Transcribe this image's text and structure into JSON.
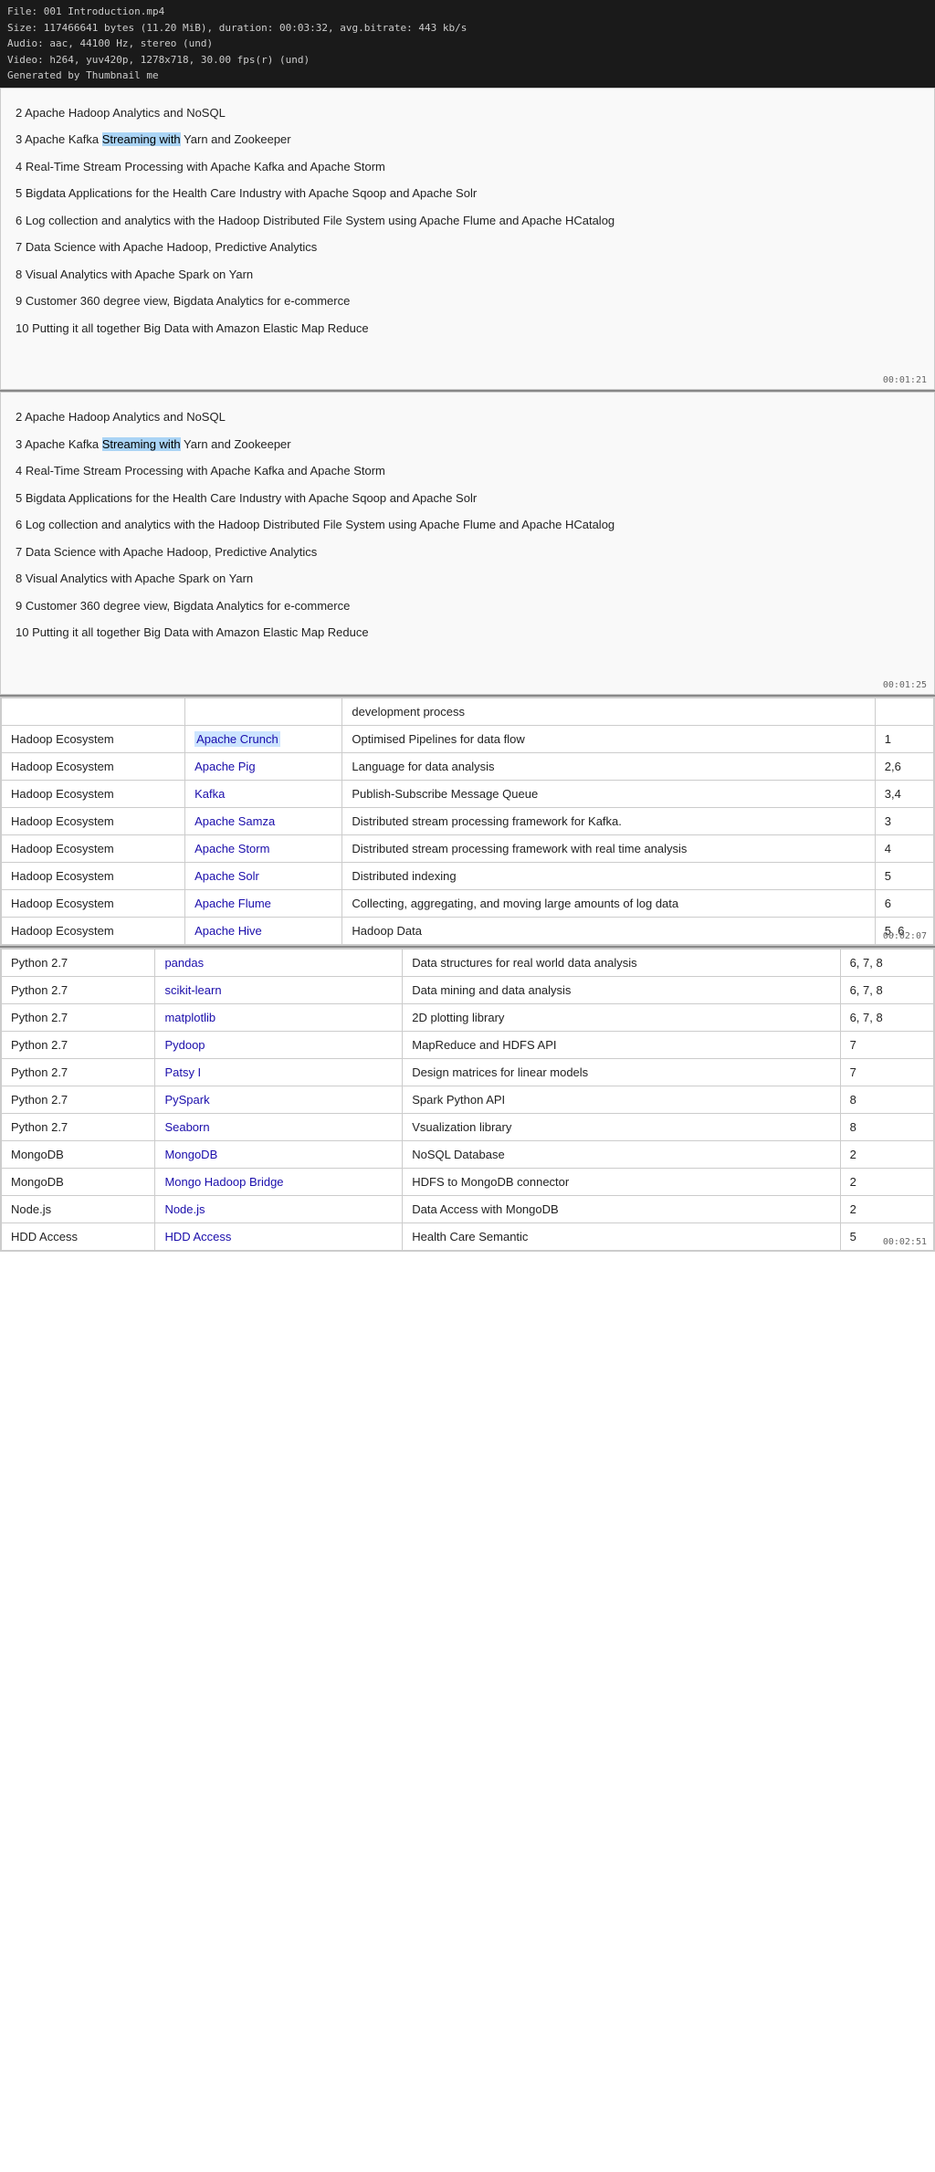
{
  "videoInfo": {
    "file": "File: 001 Introduction.mp4",
    "size": "Size: 117466641 bytes (11.20 MiB), duration: 00:03:32, avg.bitrate: 443 kb/s",
    "audio": "Audio: aac, 44100 Hz, stereo (und)",
    "video": "Video: h264, yuv420p, 1278x718, 30.00 fps(r) (und)",
    "generated": "Generated by Thumbnail me"
  },
  "panels": [
    {
      "id": "panel1",
      "timestamp": "00:01:21",
      "items": [
        {
          "num": "2",
          "text": " Apache Hadoop Analytics and NoSQL"
        },
        {
          "num": "3",
          "text": " Apache  Kafka  ",
          "highlight": "Streaming with",
          "rest": " Yarn and Zookeeper"
        },
        {
          "num": "4",
          "text": " Real-Time Stream Processing with Apache Kafka and  Apache Storm"
        },
        {
          "num": "5",
          "text": " Bigdata Applications for the Health Care Industry with Apache Sqoop and Apache Solr"
        },
        {
          "num": "6",
          "text": " Log collection and analytics with the Hadoop Distributed File System  using Apache Flume and Apache HCatalog"
        },
        {
          "num": "7",
          "text": " Data Science with Apache Hadoop,  Predictive Analytics"
        },
        {
          "num": "8",
          "text": " Visual Analytics with Apache Spark on Yarn"
        },
        {
          "num": "9",
          "text": " Customer  360 degree view,  Bigdata  Analytics for e-commerce"
        },
        {
          "num": "10",
          "text": " Putting it all together Big Data with Amazon Elastic Map Reduce"
        }
      ]
    },
    {
      "id": "panel2",
      "timestamp": "00:01:25",
      "items": [
        {
          "num": "2",
          "text": "  Apache Hadoop Analytics and NoSQL"
        },
        {
          "num": "3",
          "text": " Apache  Kafka  ",
          "highlight": "Streaming with",
          "rest": " Yarn and Zookeeper"
        },
        {
          "num": "4",
          "text": " Real-Time Stream Processing with Apache Kafka and  Apache Storm"
        },
        {
          "num": "5",
          "text": " Bigdata Applications for the Health Care Industry with Apache Sqoop and Apache Solr"
        },
        {
          "num": "6",
          "text": " Log collection and analytics with the Hadoop Distributed File System  using Apache Flume and Apache HCatalog"
        },
        {
          "num": "7",
          "text": " Data Science with Apache Hadoop,  Predictive Analytics"
        },
        {
          "num": "8",
          "text": " Visual Analytics with Apache Spark on Yarn"
        },
        {
          "num": "9",
          "text": " Customer  360 degree view,  Bigdata  Analytics for e-commerce"
        },
        {
          "num": "10",
          "text": " Putting it all together Big Data with Amazon Elastic Map Reduce"
        }
      ]
    }
  ],
  "tables": [
    {
      "id": "table1",
      "timestamp": "00:02:07",
      "partial_top": true,
      "top_partial_row": {
        "col1": "",
        "col2": "",
        "col3": "development process",
        "col4": ""
      },
      "rows": [
        {
          "ecosystem": "Hadoop Ecosystem",
          "tool": "Apache Crunch",
          "description": "Optimised Pipelines for data flow",
          "modules": "1",
          "tool_highlight": true
        },
        {
          "ecosystem": "Hadoop Ecosystem",
          "tool": "Apache Pig",
          "description": "Language for data analysis",
          "modules": "2,6",
          "tool_highlight": true
        },
        {
          "ecosystem": "Hadoop Ecosystem",
          "tool": "Kafka",
          "description": "Publish-Subscribe Message Queue",
          "modules": "3,4",
          "tool_highlight": true
        },
        {
          "ecosystem": "Hadoop Ecosystem",
          "tool": "Apache Samza",
          "description": "Distributed stream processing framework for Kafka.",
          "modules": "3",
          "tool_highlight": true
        },
        {
          "ecosystem": "Hadoop Ecosystem",
          "tool": "Apache Storm",
          "description": "Distributed stream processing framework with real time analysis",
          "modules": "4",
          "tool_highlight": true
        },
        {
          "ecosystem": "Hadoop Ecosystem",
          "tool": "Apache Solr",
          "description": "Distributed indexing",
          "modules": "5",
          "tool_highlight": true
        },
        {
          "ecosystem": "Hadoop Ecosystem",
          "tool": "Apache Flume",
          "description": "Collecting, aggregating, and moving large amounts of log data",
          "modules": "6",
          "tool_highlight": true
        },
        {
          "ecosystem": "Hadoop Ecosystem",
          "tool": "Apache Hive",
          "description": "Hadoop  Data",
          "modules": "5, 6",
          "tool_highlight": true,
          "partial": true
        }
      ]
    },
    {
      "id": "table2",
      "timestamp": "00:02:51",
      "partial_top": true,
      "top_partial_row": {
        "col1": "Python 2.7",
        "col2": "pandas",
        "col3": "Data structures for real world data analysis",
        "col4": "6, 7, 8"
      },
      "rows": [
        {
          "ecosystem": "Python 2.7",
          "tool": "scikit-learn",
          "description": "Data mining and data analysis",
          "modules": "6, 7, 8",
          "tool_highlight": true
        },
        {
          "ecosystem": "Python 2.7",
          "tool": "matplotlib",
          "description": "2D plotting library",
          "modules": "6, 7, 8",
          "tool_highlight": true
        },
        {
          "ecosystem": "Python 2.7",
          "tool": "Pydoop",
          "description": "MapReduce and HDFS API",
          "modules": "7",
          "tool_highlight": true
        },
        {
          "ecosystem": "Python 2.7",
          "tool": "Patsy  I",
          "description": "Design matrices for linear models",
          "modules": "7",
          "tool_highlight": true
        },
        {
          "ecosystem": "Python 2.7",
          "tool": "PySpark",
          "description": "Spark Python API",
          "modules": "8",
          "tool_highlight": true
        },
        {
          "ecosystem": "Python 2.7",
          "tool": "Seaborn",
          "description": "Vsualization library",
          "modules": "8",
          "tool_highlight": true
        },
        {
          "ecosystem": "MongoDB",
          "tool": "MongoDB",
          "description": "NoSQL Database",
          "modules": "2",
          "tool_highlight": true
        },
        {
          "ecosystem": "MongoDB",
          "tool": "Mongo Hadoop Bridge",
          "description": "HDFS to MongoDB connector",
          "modules": "2",
          "tool_highlight": true
        },
        {
          "ecosystem": "Node.js",
          "tool": "Node.js",
          "description": "Data  Access with MongoDB",
          "modules": "2",
          "tool_highlight": true
        },
        {
          "ecosystem": "HDD Access",
          "tool": "HDD Access",
          "description": "Health Care Semantic",
          "modules": "5",
          "tool_highlight": true,
          "partial": true
        }
      ]
    }
  ]
}
